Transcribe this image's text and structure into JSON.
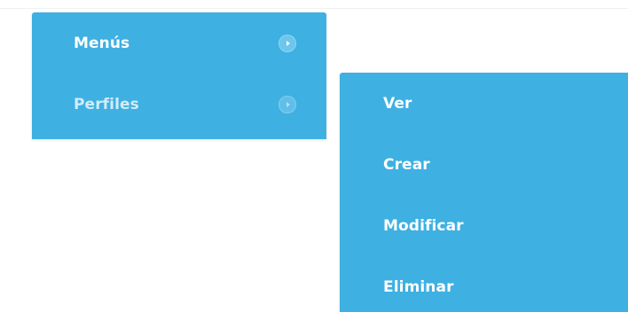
{
  "primary_menu": {
    "items": [
      {
        "label": "Menús",
        "icon": "chevron-right-circle-icon"
      },
      {
        "label": "Perfiles",
        "icon": "chevron-right-circle-icon"
      }
    ]
  },
  "submenu": {
    "items": [
      {
        "label": "Ver"
      },
      {
        "label": "Crear"
      },
      {
        "label": "Modificar"
      },
      {
        "label": "Eliminar"
      }
    ]
  },
  "colors": {
    "menu_bg": "#3eb0e2",
    "text": "#ffffff",
    "active_text": "#d2ecf8"
  }
}
